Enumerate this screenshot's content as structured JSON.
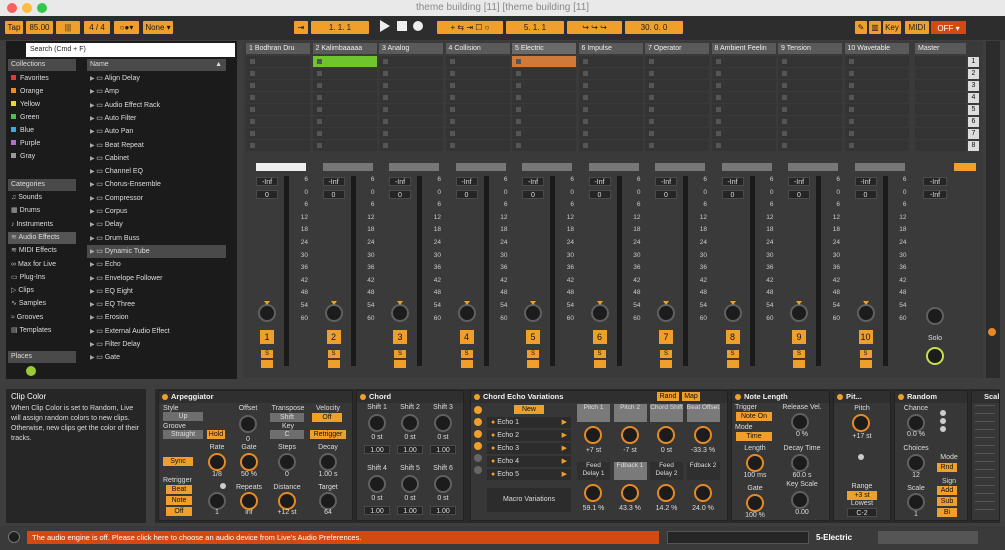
{
  "title": "theme building [11]  [theme building [11]",
  "toolbar": {
    "tap": "Tap",
    "bpm": "85.00",
    "sig": "4 / 4",
    "none": "None",
    "pos1": "1.  1.  1",
    "pos2": "5.  1.  1",
    "pos3": "30.  0.  0",
    "key": "Key",
    "midi": "MIDI",
    "off": "OFF"
  },
  "browser": {
    "search": "Search (Cmd + F)",
    "collections_label": "Collections",
    "collections": [
      {
        "label": "Favorites",
        "color": "#e23a3a"
      },
      {
        "label": "Orange",
        "color": "#f08a25"
      },
      {
        "label": "Yellow",
        "color": "#ecd634"
      },
      {
        "label": "Green",
        "color": "#45c34c"
      },
      {
        "label": "Blue",
        "color": "#3aa9e8"
      },
      {
        "label": "Purple",
        "color": "#b06fd0"
      },
      {
        "label": "Gray",
        "color": "#999999"
      }
    ],
    "categories_label": "Categories",
    "categories": [
      "Sounds",
      "Drums",
      "Instruments",
      "Audio Effects",
      "MIDI Effects",
      "Max for Live",
      "Plug-Ins",
      "Clips",
      "Samples",
      "Grooves",
      "Templates"
    ],
    "places_label": "Places",
    "name_header": "Name",
    "items": [
      "Align Delay",
      "Amp",
      "Audio Effect Rack",
      "Auto Filter",
      "Auto Pan",
      "Beat Repeat",
      "Cabinet",
      "Channel EQ",
      "Chorus-Ensemble",
      "Compressor",
      "Corpus",
      "Delay",
      "Drum Buss",
      "Dynamic Tube",
      "Echo",
      "Envelope Follower",
      "EQ Eight",
      "EQ Three",
      "Erosion",
      "External Audio Effect",
      "Filter Delay",
      "Gate"
    ]
  },
  "tracks": [
    {
      "name": "1 Bodhran Dru",
      "num": "1"
    },
    {
      "name": "2 Kalimbaaaaa",
      "num": "2"
    },
    {
      "name": "3 Analog",
      "num": "3"
    },
    {
      "name": "4 Collision",
      "num": "4"
    },
    {
      "name": "5 Electric",
      "num": "5"
    },
    {
      "name": "6 Impulse",
      "num": "6"
    },
    {
      "name": "7 Operator",
      "num": "7"
    },
    {
      "name": "8 Ambient Feelin",
      "num": "8"
    },
    {
      "name": "9 Tension",
      "num": "9"
    },
    {
      "name": "10 Wavetable",
      "num": "10"
    }
  ],
  "master": {
    "name": "Master",
    "solo": "Solo",
    "scenes": [
      "1",
      "2",
      "3",
      "4",
      "5",
      "6",
      "7",
      "8"
    ]
  },
  "mixer": {
    "inf": "-Inf",
    "zero": "0",
    "scale": [
      "6",
      "0",
      "6",
      "12",
      "18",
      "24",
      "30",
      "36",
      "42",
      "48",
      "54",
      "60"
    ],
    "s": "S"
  },
  "info": {
    "title": "Clip Color",
    "text": "When Clip Color is set to Random, Live will assign random colors to new clips. Otherwise, new clips get the color of their tracks."
  },
  "arp": {
    "name": "Arpeggiator",
    "style_l": "Style",
    "style": "Up",
    "groove_l": "Groove",
    "groove": "Straight",
    "hold": "Hold",
    "offset_l": "Offset",
    "offset": "0",
    "rate_l": "Rate",
    "rate": "1/8",
    "gate_l": "Gate",
    "gate": "50 %",
    "sync": "Sync",
    "retrig_l": "Retrigger",
    "beat": "Beat",
    "note": "Note",
    "off": "Off",
    "repeats_l": "Repeats",
    "repeats": "inf",
    "one": "1",
    "transpose_l": "Transpose",
    "shift": "Shift",
    "key_l": "Key",
    "key": "C",
    "steps_l": "Steps",
    "steps": "0",
    "distance_l": "Distance",
    "distance": "+12 st",
    "velocity_l": "Velocity",
    "vel_off": "Off",
    "retrigger": "Retrigger",
    "decay_l": "Decay",
    "decay": "1.00 s",
    "target_l": "Target",
    "target": "64"
  },
  "chord": {
    "name": "Chord",
    "shifts": [
      "Shift 1",
      "Shift 2",
      "Shift 3",
      "Shift 4",
      "Shift 5",
      "Shift 6"
    ],
    "st": "0 st",
    "v": "1.00"
  },
  "echo": {
    "name": "Chord Echo Variations",
    "rand": "Rand",
    "map": "Map",
    "new": "New",
    "items": [
      "Echo 1",
      "Echo 2",
      "Echo 3",
      "Echo 4",
      "Echo 5"
    ],
    "macro": "Macro Variations",
    "knobs": [
      {
        "l": "Pitch 1",
        "v": "+7 st"
      },
      {
        "l": "Pitch 2",
        "v": "-7 st"
      },
      {
        "l": "Chord Shift",
        "v": "0 st"
      },
      {
        "l": "Beat Offset",
        "v": "-33.3 %"
      },
      {
        "l": "Feed Delay 1",
        "v": "59.1 %"
      },
      {
        "l": "Fdback 1",
        "v": "43.3 %"
      },
      {
        "l": "Feed Delay 2",
        "v": "14.2 %"
      },
      {
        "l": "Fdback 2",
        "v": "24.0 %"
      }
    ]
  },
  "notelen": {
    "name": "Note Length",
    "trigger_l": "Trigger",
    "trigger": "Note On",
    "mode_l": "Mode",
    "mode": "Time",
    "release_l": "Release Vel.",
    "release": "0 %",
    "length_l": "Length",
    "length": "100 ms",
    "decay_l": "Decay Time",
    "decay": "60.0 s",
    "gate_l": "Gate",
    "gate": "100 %",
    "keyscale_l": "Key Scale",
    "keyscale": "0.00"
  },
  "pitch": {
    "name": "Pit...",
    "pitch_l": "Pitch",
    "pitch": "+17 st",
    "range_l": "Range",
    "range": "+3 st",
    "lowest_l": "Lowest",
    "lowest": "C-2"
  },
  "random": {
    "name": "Random",
    "chance_l": "Chance",
    "chance": "0.0 %",
    "choices_l": "Choices",
    "choices": "12",
    "scale_l": "Scale",
    "scale": "1",
    "mode_l": "Mode",
    "rnd": "Rnd",
    "sign_l": "Sign",
    "add": "Add",
    "sub": "Sub",
    "bi": "Bi"
  },
  "scale_dev": {
    "name": "Scal"
  },
  "status": "The audio engine is off. Please click here to choose an audio device from Live's Audio Preferences.",
  "track_sel": "5-Electric"
}
